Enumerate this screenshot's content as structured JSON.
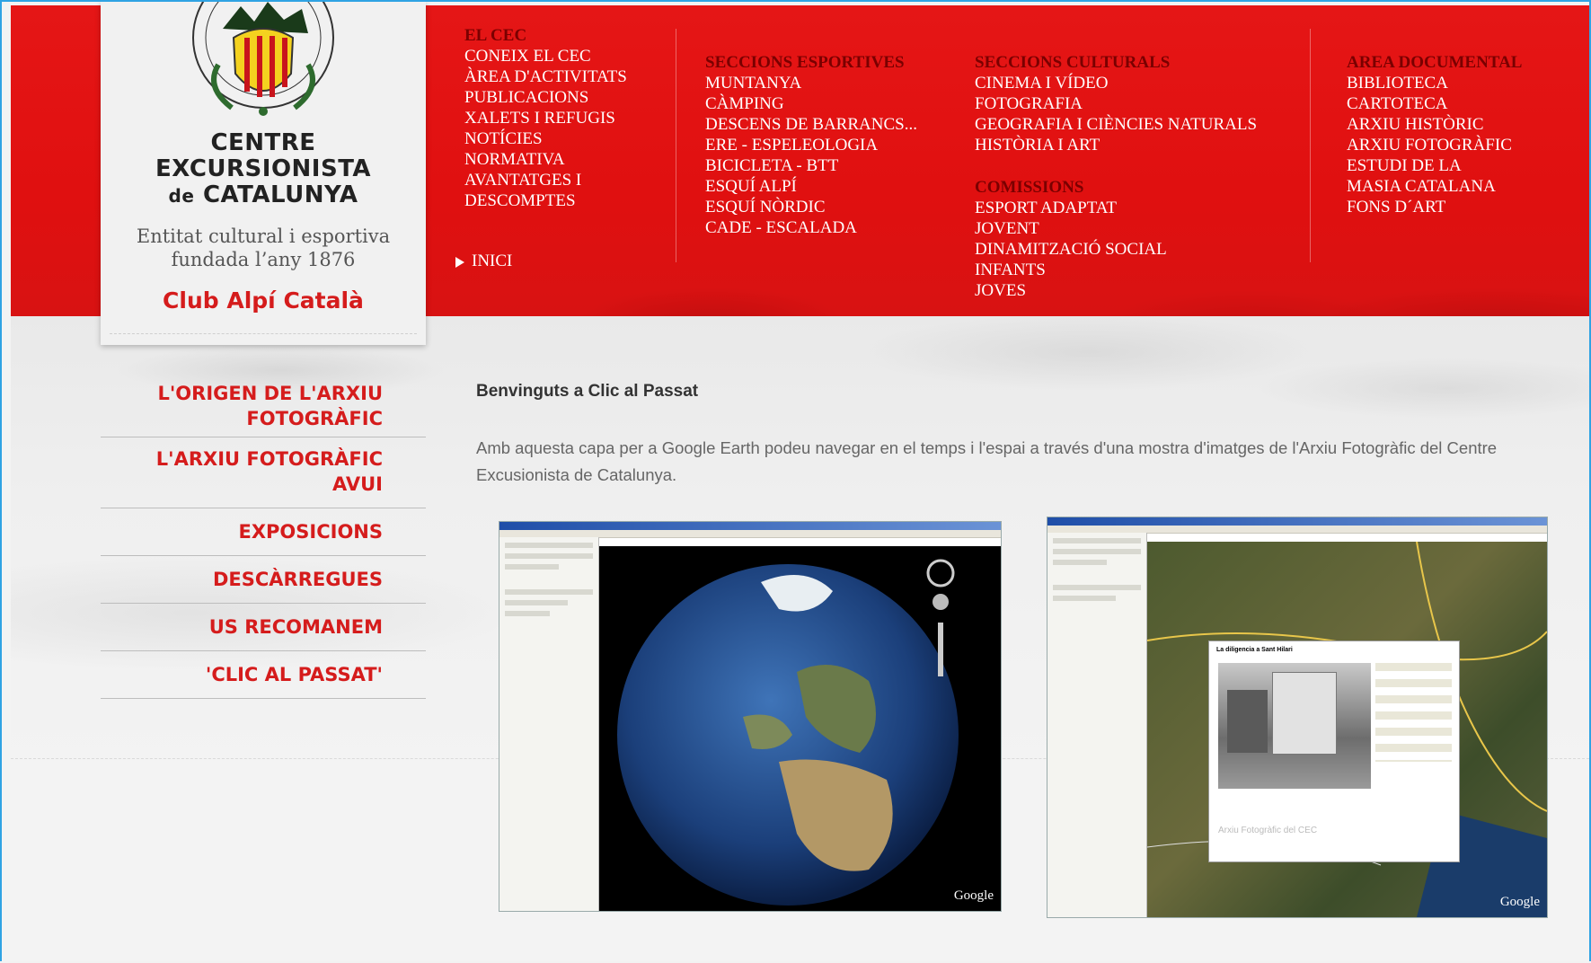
{
  "logo": {
    "org_line1": "CENTRE",
    "org_line2": "EXCURSIONISTA",
    "org_line3_prefix": "de",
    "org_line3": "CATALUNYA",
    "tagline_line1": "Entitat cultural i esportiva",
    "tagline_line2": "fundada l’any 1876",
    "club": "Club Alpí Català"
  },
  "nav": {
    "cec": {
      "heading": "EL CEC",
      "items": [
        "CONEIX EL CEC",
        "ÀREA D'ACTIVITATS",
        "PUBLICACIONS",
        "XALETS I REFUGIS",
        "NOTÍCIES",
        "NORMATIVA",
        "AVANTATGES I",
        "DESCOMPTES"
      ]
    },
    "esportives": {
      "heading": "SECCIONS ESPORTIVES",
      "items": [
        "MUNTANYA",
        "CÀMPING",
        "DESCENS DE BARRANCS...",
        "ERE - ESPELEOLOGIA",
        "BICICLETA - BTT",
        "ESQUÍ ALPÍ",
        "ESQUÍ NÒRDIC",
        "CADE - ESCALADA"
      ]
    },
    "culturals": {
      "heading": "SECCIONS CULTURALS",
      "items": [
        "CINEMA I VÍDEO",
        "FOTOGRAFIA",
        "GEOGRAFIA I CIÈNCIES NATURALS",
        "HISTÒRIA I ART"
      ]
    },
    "comissions": {
      "heading": "COMISSIONS",
      "items": [
        "ESPORT ADAPTAT",
        "JOVENT",
        "DINAMITZACIÓ SOCIAL",
        "INFANTS",
        "JOVES"
      ]
    },
    "documental": {
      "heading": "AREA DOCUMENTAL",
      "items": [
        "BIBLIOTECA",
        "CARTOTECA",
        "ARXIU HISTÒRIC",
        "ARXIU FOTOGRÀFIC",
        "ESTUDI DE LA",
        "MASIA CATALANA",
        "FONS D´ART"
      ]
    },
    "inici": "INICI"
  },
  "leftmenu": [
    {
      "line1": "L'ORIGEN DE L'ARXIU",
      "line2": "FOTOGRÀFIC"
    },
    {
      "line1": "L'ARXIU FOTOGRÀFIC AVUI"
    },
    {
      "line1": "EXPOSICIONS"
    },
    {
      "line1": "DESCÀRREGUES"
    },
    {
      "line1": "US RECOMANEM"
    },
    {
      "line1": "'CLIC AL PASSAT'"
    }
  ],
  "content": {
    "welcome": "Benvinguts a Clic al Passat",
    "intro": "Amb aquesta capa per a Google Earth podeu navegar en el temps i l'espai a través d'una mostra d'imatges de l'Arxiu Fotogràfic del Centre Excusionista de Catalunya.",
    "shot1_brand": "Google",
    "shot2_brand": "Google",
    "shot2_popup_title": "La diligencia a Sant Hilari",
    "shot2_popup_footer": "Arxiu Fotogràfic del CEC"
  },
  "colors": {
    "header_red": "#e01010",
    "heading_dark_red": "#7a0000",
    "menu_red": "#d51c1c",
    "frame_blue": "#2fa3e3"
  }
}
